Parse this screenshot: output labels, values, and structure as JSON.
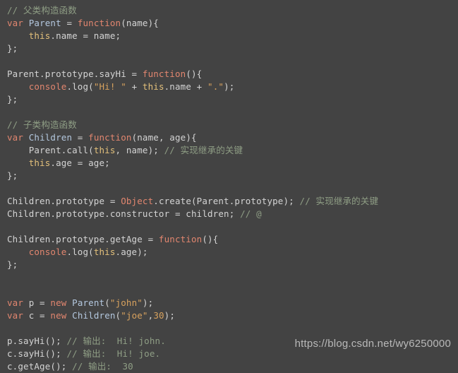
{
  "editor": {
    "background_color": "#434343",
    "language": "javascript",
    "colors": {
      "keyword": "#e2866f",
      "builtin": "#e2866f",
      "identifier": "#b4c8df",
      "string": "#d8a25e",
      "number": "#d8a25e",
      "this": "#e3c07b",
      "comment": "#8f9e85",
      "plain": "#d4d4d4"
    },
    "lines": [
      {
        "n": 1,
        "tokens": [
          {
            "t": "comment",
            "v": "// 父类构造函数"
          }
        ]
      },
      {
        "n": 2,
        "tokens": [
          {
            "t": "keyword",
            "v": "var"
          },
          {
            "t": "plain",
            "v": " "
          },
          {
            "t": "ident",
            "v": "Parent"
          },
          {
            "t": "plain",
            "v": " = "
          },
          {
            "t": "keyword",
            "v": "function"
          },
          {
            "t": "plain",
            "v": "(name){"
          }
        ]
      },
      {
        "n": 3,
        "tokens": [
          {
            "t": "plain",
            "v": "    "
          },
          {
            "t": "this",
            "v": "this"
          },
          {
            "t": "plain",
            "v": ".name = name;"
          }
        ]
      },
      {
        "n": 4,
        "tokens": [
          {
            "t": "plain",
            "v": "};"
          }
        ]
      },
      {
        "n": 5,
        "tokens": []
      },
      {
        "n": 6,
        "tokens": [
          {
            "t": "plain",
            "v": "Parent.prototype.sayHi = "
          },
          {
            "t": "keyword",
            "v": "function"
          },
          {
            "t": "plain",
            "v": "(){"
          }
        ]
      },
      {
        "n": 7,
        "tokens": [
          {
            "t": "plain",
            "v": "    "
          },
          {
            "t": "builtin",
            "v": "console"
          },
          {
            "t": "plain",
            "v": ".log("
          },
          {
            "t": "string",
            "v": "\"Hi! \""
          },
          {
            "t": "plain",
            "v": " + "
          },
          {
            "t": "this",
            "v": "this"
          },
          {
            "t": "plain",
            "v": ".name + "
          },
          {
            "t": "string",
            "v": "\".\""
          },
          {
            "t": "plain",
            "v": ");"
          }
        ]
      },
      {
        "n": 8,
        "tokens": [
          {
            "t": "plain",
            "v": "};"
          }
        ]
      },
      {
        "n": 9,
        "tokens": []
      },
      {
        "n": 10,
        "tokens": [
          {
            "t": "comment",
            "v": "// 子类构造函数"
          }
        ]
      },
      {
        "n": 11,
        "tokens": [
          {
            "t": "keyword",
            "v": "var"
          },
          {
            "t": "plain",
            "v": " "
          },
          {
            "t": "ident",
            "v": "Children"
          },
          {
            "t": "plain",
            "v": " = "
          },
          {
            "t": "keyword",
            "v": "function"
          },
          {
            "t": "plain",
            "v": "(name, age){"
          }
        ]
      },
      {
        "n": 12,
        "tokens": [
          {
            "t": "plain",
            "v": "    Parent.call("
          },
          {
            "t": "this",
            "v": "this"
          },
          {
            "t": "plain",
            "v": ", name); "
          },
          {
            "t": "comment",
            "v": "// 实现继承的关键"
          }
        ]
      },
      {
        "n": 13,
        "tokens": [
          {
            "t": "plain",
            "v": "    "
          },
          {
            "t": "this",
            "v": "this"
          },
          {
            "t": "plain",
            "v": ".age = age;"
          }
        ]
      },
      {
        "n": 14,
        "tokens": [
          {
            "t": "plain",
            "v": "};"
          }
        ]
      },
      {
        "n": 15,
        "tokens": []
      },
      {
        "n": 16,
        "tokens": [
          {
            "t": "plain",
            "v": "Children.prototype = "
          },
          {
            "t": "builtin",
            "v": "Object"
          },
          {
            "t": "plain",
            "v": ".create(Parent.prototype); "
          },
          {
            "t": "comment",
            "v": "// 实现继承的关键"
          }
        ]
      },
      {
        "n": 17,
        "tokens": [
          {
            "t": "plain",
            "v": "Children.prototype.constructor = children; "
          },
          {
            "t": "comment",
            "v": "// @"
          }
        ]
      },
      {
        "n": 18,
        "tokens": []
      },
      {
        "n": 19,
        "tokens": [
          {
            "t": "plain",
            "v": "Children.prototype.getAge = "
          },
          {
            "t": "keyword",
            "v": "function"
          },
          {
            "t": "plain",
            "v": "(){"
          }
        ]
      },
      {
        "n": 20,
        "tokens": [
          {
            "t": "plain",
            "v": "    "
          },
          {
            "t": "builtin",
            "v": "console"
          },
          {
            "t": "plain",
            "v": ".log("
          },
          {
            "t": "this",
            "v": "this"
          },
          {
            "t": "plain",
            "v": ".age);"
          }
        ]
      },
      {
        "n": 21,
        "tokens": [
          {
            "t": "plain",
            "v": "};"
          }
        ]
      },
      {
        "n": 22,
        "tokens": []
      },
      {
        "n": 23,
        "tokens": []
      },
      {
        "n": 24,
        "tokens": [
          {
            "t": "keyword",
            "v": "var"
          },
          {
            "t": "plain",
            "v": " p = "
          },
          {
            "t": "keyword",
            "v": "new"
          },
          {
            "t": "plain",
            "v": " "
          },
          {
            "t": "ident",
            "v": "Parent"
          },
          {
            "t": "plain",
            "v": "("
          },
          {
            "t": "string",
            "v": "\"john\""
          },
          {
            "t": "plain",
            "v": ");"
          }
        ]
      },
      {
        "n": 25,
        "tokens": [
          {
            "t": "keyword",
            "v": "var"
          },
          {
            "t": "plain",
            "v": " c = "
          },
          {
            "t": "keyword",
            "v": "new"
          },
          {
            "t": "plain",
            "v": " "
          },
          {
            "t": "ident",
            "v": "Children"
          },
          {
            "t": "plain",
            "v": "("
          },
          {
            "t": "string",
            "v": "\"joe\""
          },
          {
            "t": "plain",
            "v": ","
          },
          {
            "t": "number",
            "v": "30"
          },
          {
            "t": "plain",
            "v": ");"
          }
        ]
      },
      {
        "n": 26,
        "tokens": []
      },
      {
        "n": 27,
        "tokens": [
          {
            "t": "plain",
            "v": "p.sayHi(); "
          },
          {
            "t": "comment",
            "v": "// 输出:  Hi! john."
          }
        ]
      },
      {
        "n": 28,
        "tokens": [
          {
            "t": "plain",
            "v": "c.sayHi(); "
          },
          {
            "t": "comment",
            "v": "// 输出:  Hi! joe."
          }
        ]
      },
      {
        "n": 29,
        "tokens": [
          {
            "t": "plain",
            "v": "c.getAge(); "
          },
          {
            "t": "comment",
            "v": "// 输出:  30"
          }
        ]
      }
    ]
  },
  "watermark": {
    "text": "https://blog.csdn.net/wy6250000"
  }
}
